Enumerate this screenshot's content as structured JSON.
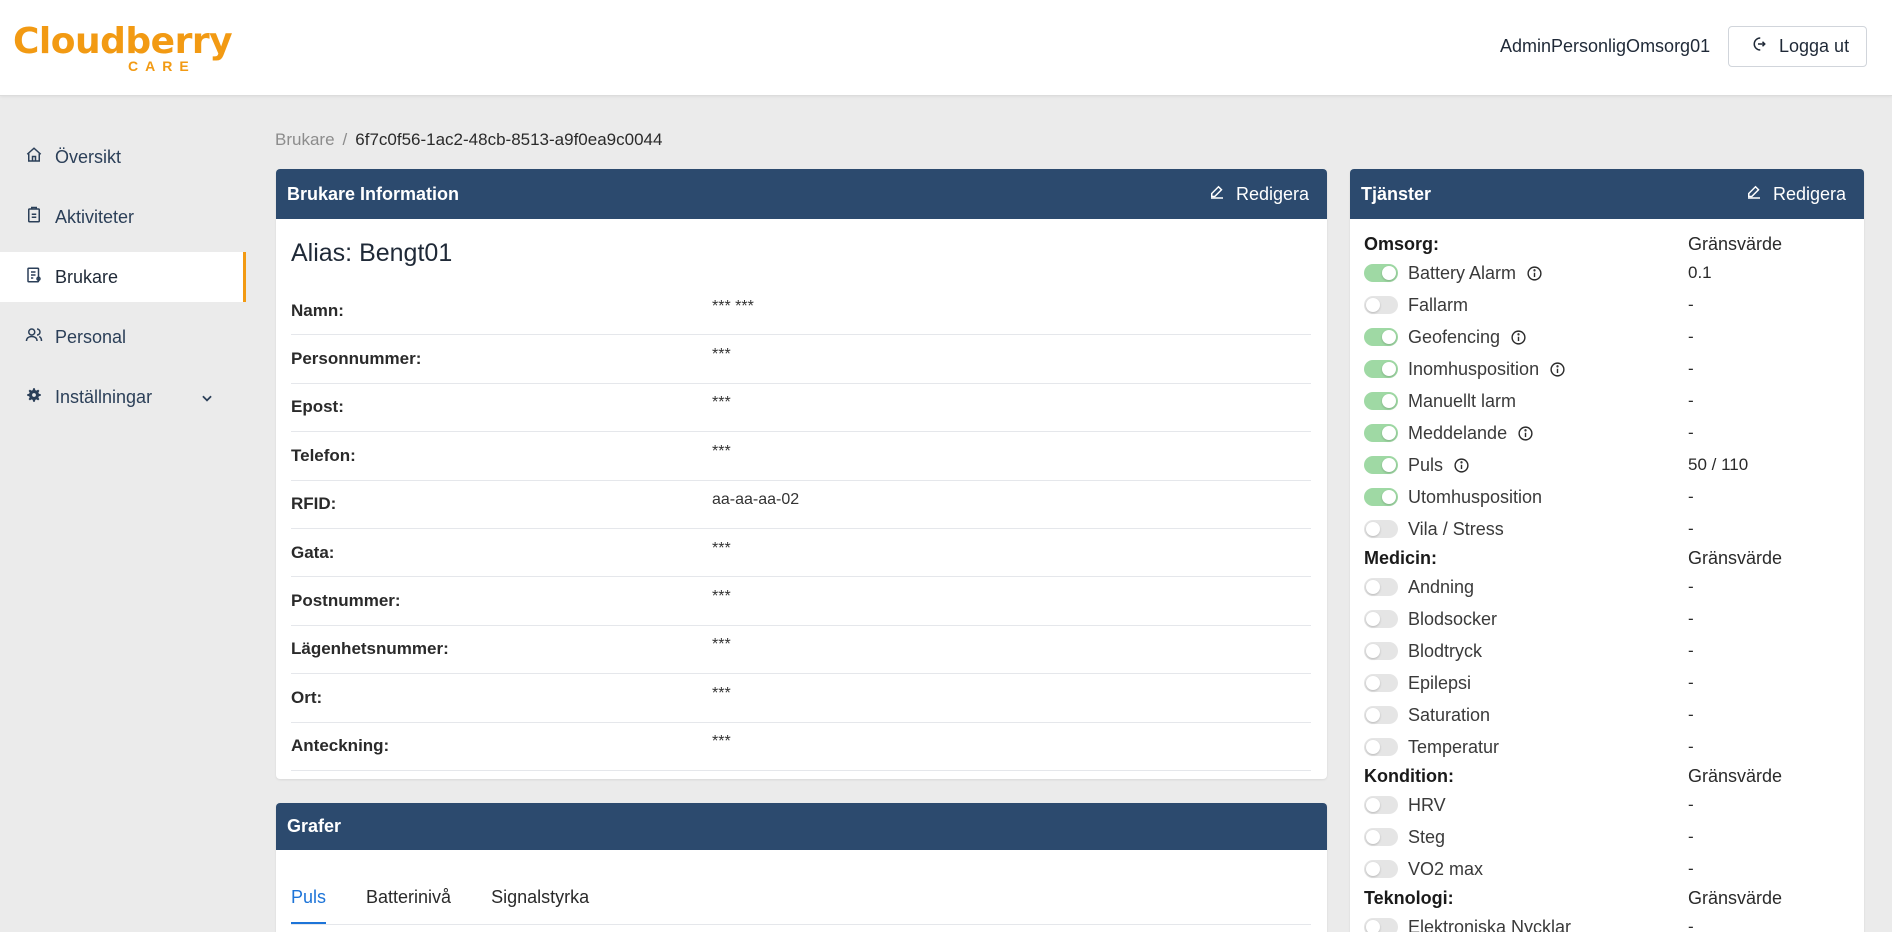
{
  "brand": {
    "main": "Cloudberry",
    "sub": "CARE"
  },
  "header": {
    "user": "AdminPersonligOmsorg01",
    "logout_label": "Logga ut"
  },
  "sidebar": {
    "items": [
      {
        "label": "Översikt",
        "icon": "home-icon"
      },
      {
        "label": "Aktiviteter",
        "icon": "clipboard-icon"
      },
      {
        "label": "Brukare",
        "icon": "user-list-icon",
        "active": true
      },
      {
        "label": "Personal",
        "icon": "people-icon"
      },
      {
        "label": "Inställningar",
        "icon": "gear-icon"
      }
    ]
  },
  "breadcrumb": {
    "parent": "Brukare",
    "separator": "/",
    "current": "6f7c0f56-1ac2-48cb-8513-a9f0ea9c0044"
  },
  "info": {
    "title": "Brukare Information",
    "edit_label": "Redigera",
    "alias": "Alias: Bengt01",
    "rows": [
      {
        "label": "Namn:",
        "value": "*** ***"
      },
      {
        "label": "Personnummer:",
        "value": "***"
      },
      {
        "label": "Epost:",
        "value": "***"
      },
      {
        "label": "Telefon:",
        "value": "***"
      },
      {
        "label": "RFID:",
        "value": "aa-aa-aa-02"
      },
      {
        "label": "Gata:",
        "value": "***"
      },
      {
        "label": "Postnummer:",
        "value": "***"
      },
      {
        "label": "Lägenhetsnummer:",
        "value": "***"
      },
      {
        "label": "Ort:",
        "value": "***"
      },
      {
        "label": "Anteckning:",
        "value": "***"
      }
    ]
  },
  "graphs": {
    "title": "Grafer",
    "tabs": [
      "Puls",
      "Batterinivå",
      "Signalstyrka"
    ],
    "active_tab": "Puls"
  },
  "services": {
    "title": "Tjänster",
    "edit_label": "Redigera",
    "groups": [
      {
        "name": "Omsorg:",
        "value_header": "Gränsvärde",
        "items": [
          {
            "name": "Battery Alarm",
            "on": true,
            "info": true,
            "value": "0.1"
          },
          {
            "name": "Fallarm",
            "on": false,
            "info": false,
            "value": "-"
          },
          {
            "name": "Geofencing",
            "on": true,
            "info": true,
            "value": "-"
          },
          {
            "name": "Inomhusposition",
            "on": true,
            "info": true,
            "value": "-"
          },
          {
            "name": "Manuellt larm",
            "on": true,
            "info": false,
            "value": "-"
          },
          {
            "name": "Meddelande",
            "on": true,
            "info": true,
            "value": "-"
          },
          {
            "name": "Puls",
            "on": true,
            "info": true,
            "value": "50 / 110"
          },
          {
            "name": "Utomhusposition",
            "on": true,
            "info": false,
            "value": "-"
          },
          {
            "name": "Vila / Stress",
            "on": false,
            "info": false,
            "value": "-"
          }
        ]
      },
      {
        "name": "Medicin:",
        "value_header": "Gränsvärde",
        "items": [
          {
            "name": "Andning",
            "on": false,
            "info": false,
            "value": "-"
          },
          {
            "name": "Blodsocker",
            "on": false,
            "info": false,
            "value": "-"
          },
          {
            "name": "Blodtryck",
            "on": false,
            "info": false,
            "value": "-"
          },
          {
            "name": "Epilepsi",
            "on": false,
            "info": false,
            "value": "-"
          },
          {
            "name": "Saturation",
            "on": false,
            "info": false,
            "value": "-"
          },
          {
            "name": "Temperatur",
            "on": false,
            "info": false,
            "value": "-"
          }
        ]
      },
      {
        "name": "Kondition:",
        "value_header": "Gränsvärde",
        "items": [
          {
            "name": "HRV",
            "on": false,
            "info": false,
            "value": "-"
          },
          {
            "name": "Steg",
            "on": false,
            "info": false,
            "value": "-"
          },
          {
            "name": "VO2 max",
            "on": false,
            "info": false,
            "value": "-"
          }
        ]
      },
      {
        "name": "Teknologi:",
        "value_header": "Gränsvärde",
        "items": [
          {
            "name": "Elektroniska Nycklar",
            "on": false,
            "info": false,
            "value": "-"
          }
        ]
      }
    ]
  },
  "colors": {
    "accent": "#f29a13",
    "header": "#2c4a6e",
    "toggle_on": "#9fd9a4",
    "link": "#1d74d8"
  }
}
